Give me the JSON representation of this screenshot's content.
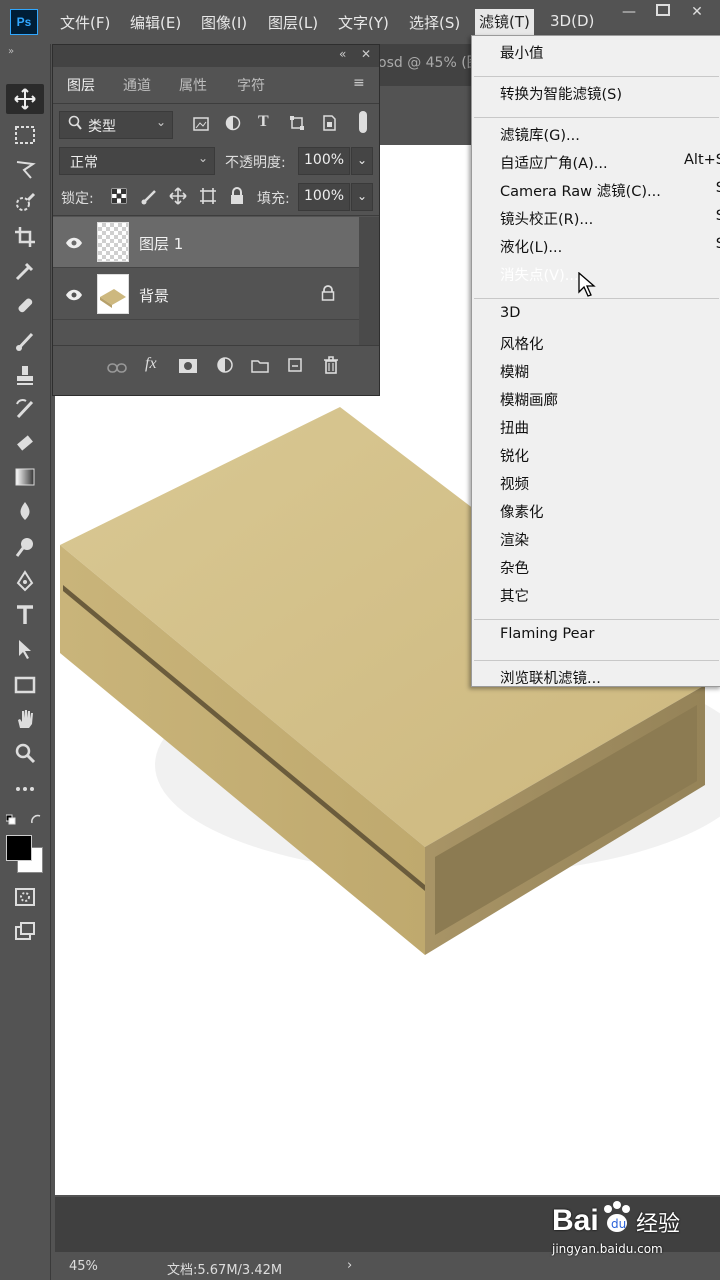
{
  "app": {
    "logo_text": "Ps"
  },
  "menubar": {
    "items": [
      "文件(F)",
      "编辑(E)",
      "图像(I)",
      "图层(L)",
      "文字(Y)",
      "选择(S)",
      "滤镜(T)",
      "3D(D)"
    ],
    "active_index": 6
  },
  "document": {
    "tab_title": "osd @ 45% (图"
  },
  "layers_panel": {
    "tabs": [
      "图层",
      "通道",
      "属性",
      "字符"
    ],
    "active_tab": 0,
    "filter_kind": "类型",
    "blend_mode": "正常",
    "opacity_label": "不透明度:",
    "opacity_value": "100%",
    "lock_label": "锁定:",
    "fill_label": "填充:",
    "fill_value": "100%",
    "layers": [
      {
        "name": "图层 1",
        "selected": true,
        "locked": false
      },
      {
        "name": "背景",
        "selected": false,
        "locked": true
      }
    ],
    "footer_fx": "fx"
  },
  "filter_menu": {
    "items": [
      {
        "label": "最小值",
        "shortcut": ""
      },
      {
        "sep": true
      },
      {
        "label": "转换为智能滤镜(S)",
        "shortcut": ""
      },
      {
        "sep": true
      },
      {
        "label": "滤镜库(G)...",
        "shortcut": ""
      },
      {
        "label": "自适应广角(A)...",
        "shortcut": "Alt+S"
      },
      {
        "label": "Camera Raw 滤镜(C)...",
        "shortcut": "S"
      },
      {
        "label": "镜头校正(R)...",
        "shortcut": "S"
      },
      {
        "label": "液化(L)...",
        "shortcut": "S"
      },
      {
        "label": "消失点(V)...",
        "shortcut": "",
        "highlighted": true
      },
      {
        "sep": true
      },
      {
        "label": "3D",
        "shortcut": ""
      },
      {
        "label": "风格化",
        "shortcut": ""
      },
      {
        "label": "模糊",
        "shortcut": ""
      },
      {
        "label": "模糊画廊",
        "shortcut": ""
      },
      {
        "label": "扭曲",
        "shortcut": ""
      },
      {
        "label": "锐化",
        "shortcut": ""
      },
      {
        "label": "视频",
        "shortcut": ""
      },
      {
        "label": "像素化",
        "shortcut": ""
      },
      {
        "label": "渲染",
        "shortcut": ""
      },
      {
        "label": "杂色",
        "shortcut": ""
      },
      {
        "label": "其它",
        "shortcut": ""
      },
      {
        "sep": true
      },
      {
        "label": "Flaming Pear",
        "shortcut": ""
      },
      {
        "sep": true
      },
      {
        "label": "浏览联机滤镜...",
        "shortcut": ""
      }
    ]
  },
  "statusbar": {
    "zoom": "45%",
    "doc_info": "文档:5.67M/3.42M"
  },
  "watermark": {
    "brand": "Bai",
    "brand2": "经验",
    "url": "jingyan.baidu.com"
  },
  "colors": {
    "highlight": "#3e91ff",
    "canvas_bg": "#ffffff",
    "box": "#cfbb83"
  }
}
